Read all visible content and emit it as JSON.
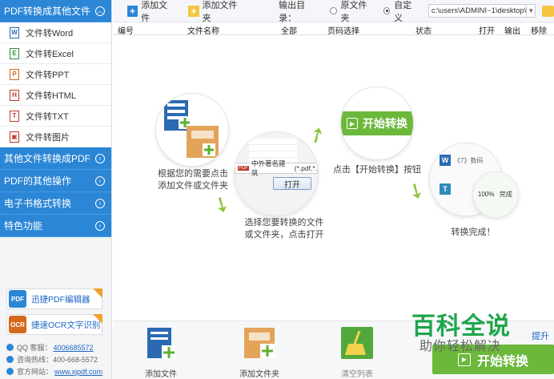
{
  "sidebar": {
    "sections": [
      {
        "label": "PDF转换成其他文件",
        "expanded": true
      },
      {
        "label": "其他文件转换成PDF"
      },
      {
        "label": "PDF的其他操作"
      },
      {
        "label": "电子书格式转换"
      },
      {
        "label": "特色功能"
      }
    ],
    "items": [
      {
        "label": "文件转Word",
        "icon": "word-file-icon",
        "color": "#2b6ab3",
        "glyph": "W"
      },
      {
        "label": "文件转Excel",
        "icon": "excel-file-icon",
        "color": "#2e8b3e",
        "glyph": "E"
      },
      {
        "label": "文件转PPT",
        "icon": "ppt-file-icon",
        "color": "#d2691e",
        "glyph": "P"
      },
      {
        "label": "文件转HTML",
        "icon": "html-file-icon",
        "color": "#c0392b",
        "glyph": "H"
      },
      {
        "label": "文件转TXT",
        "icon": "txt-file-icon",
        "color": "#c0392b",
        "glyph": "T"
      },
      {
        "label": "文件转图片",
        "icon": "image-file-icon",
        "color": "#c0392b",
        "glyph": "▣"
      }
    ],
    "promos": [
      {
        "label": "迅捷PDF编辑器",
        "icon": "pdf-editor-icon",
        "badge": "PDF"
      },
      {
        "label": "捷速OCR文字识别",
        "icon": "ocr-icon",
        "badge": "OCR"
      }
    ],
    "contact": {
      "qq_label": "QQ 客服：",
      "qq_value": "4006685572",
      "hotline_label": "咨询热线：",
      "hotline_value": "400-668-5572",
      "site_label": "官方网站：",
      "site_value": "www.xjpdf.com"
    }
  },
  "toolbar": {
    "add_file": "添加文件",
    "add_folder": "添加文件夹",
    "output_label": "输出目录：",
    "option_original": "原文件夹",
    "option_custom": "自定义",
    "output_path": "c:\\users\\ADMINI~1\\desktop\\"
  },
  "table": {
    "headers": [
      "编号",
      "文件名称",
      "全部",
      "页码选择",
      "状态",
      "打开",
      "输出",
      "移除"
    ]
  },
  "guide": {
    "step1": "根据您的需要点击\n添加文件或文件夹",
    "step2_line1": "选择您要转换的文件",
    "step2_line2": "或文件夹，点击打开",
    "dialog_filename": "中外著名建筑",
    "dialog_filter": "(*.pdf,*.",
    "dialog_open": "打开",
    "step3_button": "开始转换",
    "step3": "点击【开始转换】按钮",
    "step4": "转换完成！",
    "result_row1": "《7》数码",
    "result_row2_percent": "100%",
    "result_row2_status": "完成"
  },
  "bottom": {
    "add_file": "添加文件",
    "add_folder": "添加文件夹",
    "clear_list": "清空列表",
    "start": "开始转换",
    "upgrade": "提升"
  },
  "watermark": {
    "title": "百科全说",
    "subtitle": "助你轻松解决"
  }
}
